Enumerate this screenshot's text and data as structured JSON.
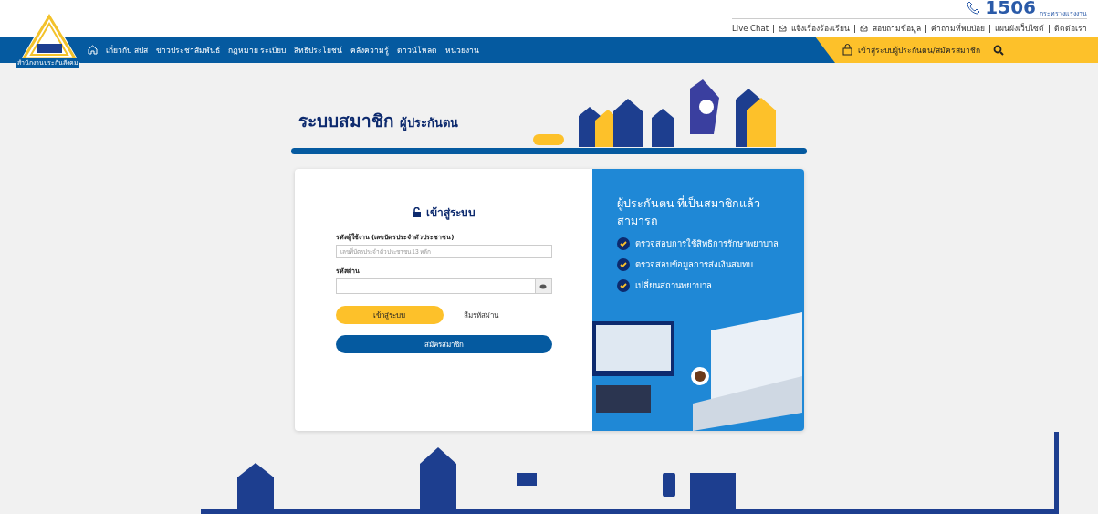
{
  "header": {
    "logo_caption": "สำนักงานประกันสังคม",
    "hotline": "1506",
    "hotline_caption": "กระทรวงแรงงาน",
    "top_links": [
      "Live Chat",
      "แจ้งเรื่องร้องเรียน",
      "สอบถามข้อมูล",
      "คำถามที่พบบ่อย",
      "แผนผังเว็บไซต์",
      "ติดต่อเรา"
    ],
    "nav": [
      "เกี่ยวกับ สปส",
      "ข่าวประชาสัมพันธ์",
      "กฎหมาย ระเบียบ",
      "สิทธิประโยชน์",
      "คลังความรู้",
      "ดาวน์โหลด",
      "หน่วยงาน"
    ],
    "login_link": "เข้าสู่ระบบผู้ประกันตน/สมัครสมาชิก"
  },
  "banner": {
    "title": "ระบบสมาชิก",
    "subtitle": "ผู้ประกันตน"
  },
  "login": {
    "title": "เข้าสู่ระบบ",
    "username_label": "รหัสผู้ใช้งาน (เลขบัตรประจำตัวประชาชน)",
    "username_placeholder": "เลขที่บัตรประจำตัวประชาชน 13 หลัก",
    "password_label": "รหัสผ่าน",
    "login_button": "เข้าสู่ระบบ",
    "forgot_link": "ลืมรหัสผ่าน",
    "register_button": "สมัครสมาชิก"
  },
  "promo": {
    "title": "ผู้ประกันตน ที่เป็นสมาชิกแล้ว สามารถ",
    "items": [
      "ตรวจสอบการใช้สิทธิการรักษาพยาบาล",
      "ตรวจสอบข้อมูลการส่งเงินสมทบ",
      "เปลี่ยนสถานพยาบาล"
    ]
  }
}
